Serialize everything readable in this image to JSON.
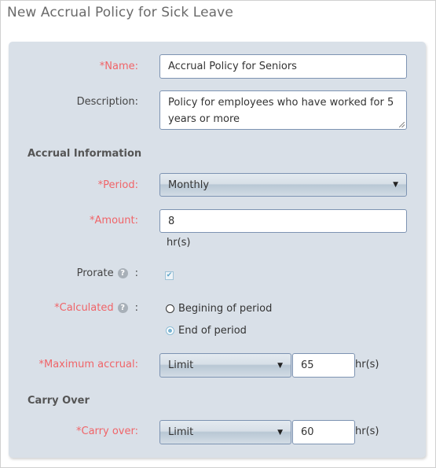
{
  "title": "New Accrual Policy for Sick Leave",
  "form": {
    "name": {
      "label": "*Name:",
      "value": "Accrual Policy for Seniors"
    },
    "description": {
      "label": "Description:",
      "value": "Policy for employees who have worked for 5 years or more"
    },
    "accrual_section": "Accrual Information",
    "period": {
      "label": "*Period:",
      "value": "Monthly"
    },
    "amount": {
      "label": "*Amount:",
      "value": "8",
      "unit": "hr(s)"
    },
    "prorate": {
      "label": "Prorate",
      "colon": ":",
      "checked": true,
      "check_glyph": "✔"
    },
    "calculated": {
      "label": "*Calculated",
      "colon": ":",
      "options": [
        {
          "label": "Begining of period",
          "selected": false
        },
        {
          "label": "End of period",
          "selected": true
        }
      ]
    },
    "max_accrual": {
      "label": "*Maximum accrual:",
      "mode": "Limit",
      "value": "65",
      "unit": "hr(s)"
    },
    "carry_section": "Carry Over",
    "carry_over": {
      "label": "*Carry over:",
      "mode": "Limit",
      "value": "60",
      "unit": "hr(s)"
    }
  },
  "icons": {
    "help": "?",
    "dropdown_arrow": "▼"
  }
}
